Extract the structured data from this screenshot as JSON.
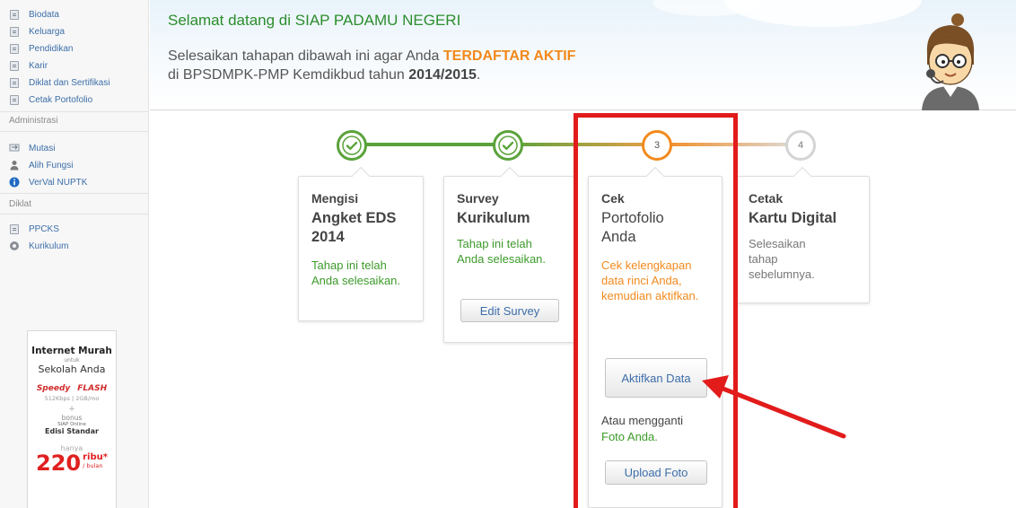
{
  "sidebar": {
    "portfolio_items": [
      {
        "label": "Biodata",
        "icon": "document-icon"
      },
      {
        "label": "Keluarga",
        "icon": "document-icon"
      },
      {
        "label": "Pendidikan",
        "icon": "document-icon"
      },
      {
        "label": "Karir",
        "icon": "document-icon"
      },
      {
        "label": "Diklat dan Sertifikasi",
        "icon": "document-icon"
      },
      {
        "label": "Cetak Portofolio",
        "icon": "document-icon"
      }
    ],
    "administrasi_heading": "Administrasi",
    "administrasi_items": [
      {
        "label": "Mutasi",
        "icon": "transfer-icon"
      },
      {
        "label": "Alih Fungsi",
        "icon": "person-icon"
      },
      {
        "label": "VerVal NUPTK",
        "icon": "info-icon"
      }
    ],
    "diklat_heading": "Diklat",
    "diklat_items": [
      {
        "label": "PPCKS",
        "icon": "document-icon"
      },
      {
        "label": "Kurikulum",
        "icon": "gear-icon"
      }
    ],
    "ad": {
      "line1": "Internet Murah",
      "line2": "untuk",
      "line3": "Sekolah Anda",
      "brand1": "Speedy",
      "brand2": "FLASH",
      "brand1_sub": "512Kbps",
      "brand2_sub": "2GB/mo",
      "plus": "+",
      "bonus": "bonus",
      "siap": "SIAP Online",
      "edisi": "Edisi Standar",
      "hanya": "hanya",
      "price": "220",
      "ribu": "ribu*",
      "bulan": "/ bulan"
    }
  },
  "header": {
    "welcome": "Selamat datang di SIAP PADAMU NEGERI",
    "intro_prefix": "Selesaikan tahapan dibawah ini agar Anda ",
    "intro_highlight": "TERDAFTAR AKTIF",
    "intro_line2_prefix": "di BPSDMPK-PMP Kemdikbud tahun ",
    "intro_year": "2014/2015",
    "intro_suffix": "."
  },
  "steps": [
    {
      "number": "✓",
      "status": "done",
      "title1": "Mengisi",
      "title2": "Angket EDS",
      "title3": "2014",
      "desc": "Tahap ini telah Anda selesaikan."
    },
    {
      "number": "✓",
      "status": "done",
      "title1": "Survey",
      "title2": "Kurikulum",
      "desc": "Tahap ini telah Anda selesaikan.",
      "button": "Edit Survey"
    },
    {
      "number": "3",
      "status": "active",
      "title1": "Cek",
      "title2": "Portofolio",
      "title3": "Anda",
      "desc": "Cek kelengkapan data rinci Anda, kemudian aktifkan.",
      "button": "Aktifkan Data",
      "alt_text": "Atau mengganti",
      "alt_text2": "Foto Anda.",
      "button2": "Upload Foto"
    },
    {
      "number": "4",
      "status": "pending",
      "title1": "Cetak",
      "title2": "Kartu Digital",
      "desc": "Selesaikan tahap sebelumnya."
    }
  ],
  "colors": {
    "done": "#5aa33a",
    "active": "#f28a1e",
    "pending": "#c8c8c8",
    "highlight_box": "#e21b1b",
    "arrow": "#e21b1b"
  }
}
